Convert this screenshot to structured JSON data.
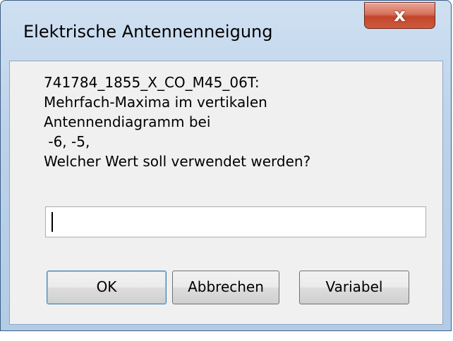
{
  "window": {
    "title": "Elektrische Antennenneigung",
    "close_label": "x"
  },
  "dialog": {
    "message": "741784_1855_X_CO_M45_06T:\nMehrfach-Maxima im vertikalen\nAntennendiagramm bei\n -6, -5,\nWelcher Wert soll verwendet werden?",
    "input_value": "",
    "buttons": {
      "ok": "OK",
      "cancel": "Abbrechen",
      "variable": "Variabel"
    }
  }
}
